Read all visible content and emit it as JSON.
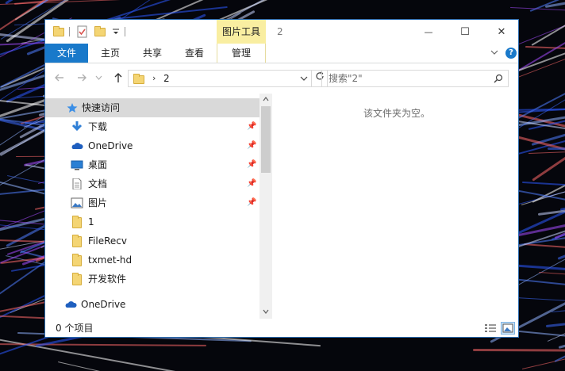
{
  "window": {
    "title": "2",
    "context_tab_group": "图片工具",
    "controls": {
      "minimize": "—",
      "maximize": "☐",
      "close": "✕"
    }
  },
  "ribbon": {
    "tabs": [
      {
        "label": "文件"
      },
      {
        "label": "主页"
      },
      {
        "label": "共享"
      },
      {
        "label": "查看"
      },
      {
        "label": "管理"
      }
    ],
    "expand_icon": "chevron-down-icon",
    "help_label": "?"
  },
  "navigation": {
    "back_icon": "arrow-left-icon",
    "forward_icon": "arrow-right-icon",
    "recent_icon": "chevron-down-icon",
    "up_icon": "arrow-up-icon",
    "address": {
      "segment": "2"
    },
    "search": {
      "placeholder": "搜索\"2\""
    }
  },
  "nav_pane": {
    "items": [
      {
        "label": "快速访问",
        "icon": "star-icon",
        "pinned": false
      },
      {
        "label": "下载",
        "icon": "download-icon",
        "pinned": true
      },
      {
        "label": "OneDrive",
        "icon": "cloud-icon",
        "pinned": true
      },
      {
        "label": "桌面",
        "icon": "desktop-icon",
        "pinned": true
      },
      {
        "label": "文档",
        "icon": "document-icon",
        "pinned": true
      },
      {
        "label": "图片",
        "icon": "picture-icon",
        "pinned": true
      },
      {
        "label": "1",
        "icon": "folder-icon",
        "pinned": false
      },
      {
        "label": "FileRecv",
        "icon": "folder-icon",
        "pinned": false
      },
      {
        "label": "txmet-hd",
        "icon": "folder-icon",
        "pinned": false
      },
      {
        "label": "开发软件",
        "icon": "folder-icon",
        "pinned": false
      },
      {
        "label": "OneDrive",
        "icon": "cloud-icon",
        "pinned": false
      }
    ]
  },
  "content": {
    "empty_message": "该文件夹为空。"
  },
  "status": {
    "item_count": "0 个项目"
  },
  "colors": {
    "accent": "#1979ca",
    "context_tab": "#f9eea1",
    "selection": "#d9d9d9"
  }
}
